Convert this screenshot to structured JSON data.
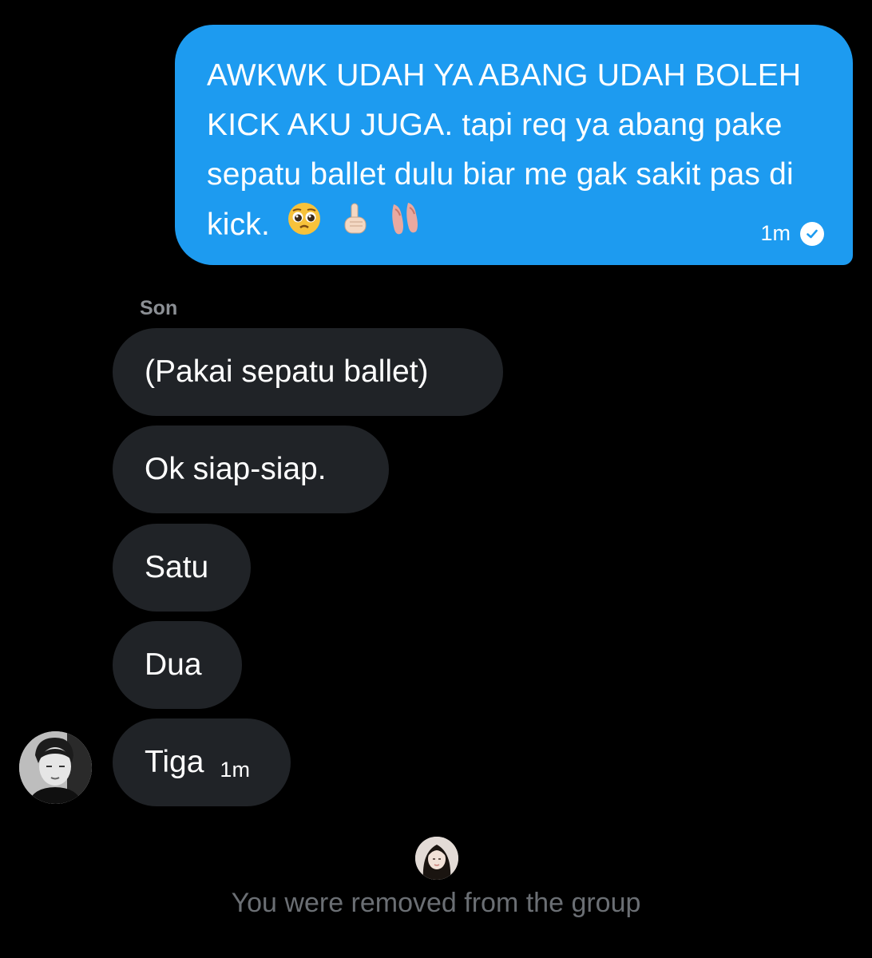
{
  "sent_message": {
    "text": "AWKWK UDAH YA ABANG UDAH BOLEH KICK AKU JUGA. tapi req ya abang pake sepatu ballet dulu biar me gak sakit pas di kick.",
    "emojis": [
      "pleading-face",
      "index-pointing-up",
      "ballet-shoes"
    ],
    "time": "1m",
    "status_icon": "check-circle-icon"
  },
  "conversation": {
    "sender_name": "Son",
    "received_messages": [
      {
        "text": "(Pakai sepatu ballet)"
      },
      {
        "text": "Ok siap-siap."
      },
      {
        "text": "Satu"
      },
      {
        "text": "Dua"
      },
      {
        "text": "Tiga",
        "time": "1m"
      }
    ]
  },
  "system_message": {
    "text": "You were removed from the group"
  },
  "colors": {
    "background": "#000000",
    "sent_bubble": "#1d9bf0",
    "received_bubble": "#202327",
    "sender_name": "#8b8f94",
    "system_text": "#6b6f74"
  }
}
